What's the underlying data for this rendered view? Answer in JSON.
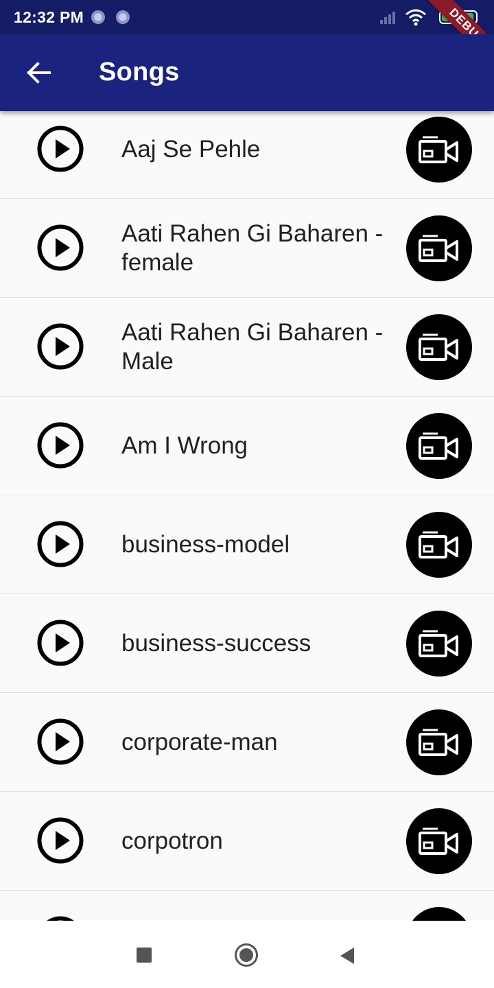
{
  "status_bar": {
    "time": "12:32 PM",
    "battery": "91",
    "debug_banner": "DEBUG"
  },
  "app_bar": {
    "title": "Songs"
  },
  "songs": [
    {
      "title": "Aaj Se Pehle"
    },
    {
      "title": "Aati Rahen Gi Baharen - female"
    },
    {
      "title": "Aati Rahen Gi Baharen - Male"
    },
    {
      "title": "Am I Wrong"
    },
    {
      "title": "business-model"
    },
    {
      "title": "business-success"
    },
    {
      "title": "corporate-man"
    },
    {
      "title": "corpotron"
    },
    {
      "title": ""
    }
  ],
  "icons": {
    "back": "arrow-back-icon",
    "play": "play-circle-icon",
    "video": "video-camera-icon",
    "nav_recents": "square-icon",
    "nav_home": "circle-icon",
    "nav_back": "triangle-back-icon"
  },
  "colors": {
    "status_bar": "#141c66",
    "app_bar": "#1a237e",
    "background": "#fafafa",
    "debug_banner": "#8b1a2a"
  }
}
